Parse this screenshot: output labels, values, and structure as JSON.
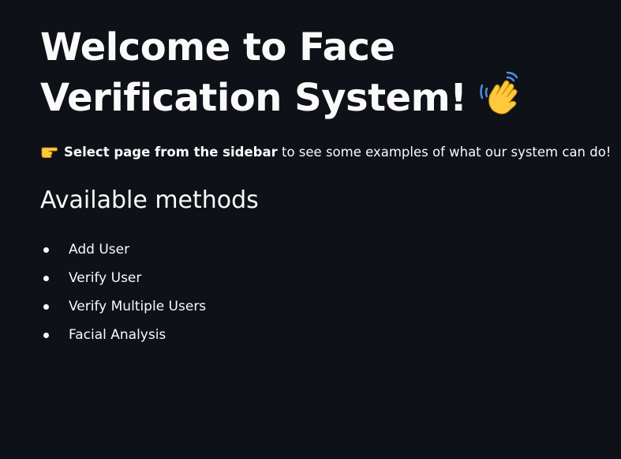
{
  "page": {
    "title": "Welcome to Face Verification System!",
    "title_icon": "waving-hand-emoji",
    "intro": {
      "icon": "pointing-hand-emoji",
      "bold_text": "Select page from the sidebar",
      "rest_text": " to see some examples of what our system can do!"
    },
    "subheading": "Available methods",
    "methods": [
      "Add User",
      "Verify User",
      "Verify Multiple Users",
      "Facial Analysis"
    ]
  },
  "colors": {
    "background": "#0e1117",
    "text": "#fafafa",
    "emoji_yellow": "#ffc83d",
    "emoji_blue": "#4a90e2"
  }
}
